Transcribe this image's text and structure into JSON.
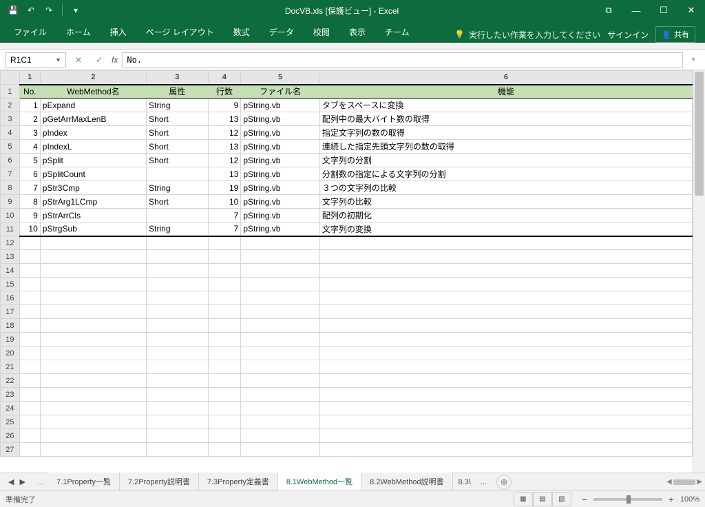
{
  "title": "DocVB.xls  [保護ビュー] - Excel",
  "qat": {
    "save": "💾",
    "undo": "↶",
    "redo": "↷",
    "more": "▾"
  },
  "win": {
    "restore_size": "⧉",
    "min": "—",
    "max": "☐",
    "close": "✕"
  },
  "ribbon": {
    "tabs": [
      "ファイル",
      "ホーム",
      "挿入",
      "ページ レイアウト",
      "数式",
      "データ",
      "校閲",
      "表示",
      "チーム"
    ],
    "tell_me": "実行したい作業を入力してください",
    "signin": "サインイン",
    "share": "共有"
  },
  "name_box": "R1C1",
  "formula": "No.",
  "col_headers": [
    "1",
    "2",
    "3",
    "4",
    "5",
    "6"
  ],
  "row_headers": [
    "1",
    "2",
    "3",
    "4",
    "5",
    "6",
    "7",
    "8",
    "9",
    "10",
    "11",
    "12",
    "13",
    "14",
    "15",
    "16",
    "17",
    "18",
    "19",
    "20",
    "21",
    "22",
    "23",
    "24",
    "25",
    "26",
    "27"
  ],
  "table": {
    "headers": [
      "No.",
      "WebMethod名",
      "属性",
      "行数",
      "ファイル名",
      "機能"
    ],
    "rows": [
      {
        "no": "1",
        "name": "pExpand",
        "attr": "String",
        "lines": "9",
        "file": "pString.vb",
        "func": "タブをスペースに変換"
      },
      {
        "no": "2",
        "name": "pGetArrMaxLenB",
        "attr": "Short",
        "lines": "13",
        "file": "pString.vb",
        "func": "配列中の最大バイト数の取得"
      },
      {
        "no": "3",
        "name": "pIndex",
        "attr": "Short",
        "lines": "12",
        "file": "pString.vb",
        "func": "指定文字列の数の取得"
      },
      {
        "no": "4",
        "name": "pIndexL",
        "attr": "Short",
        "lines": "13",
        "file": "pString.vb",
        "func": "連続した指定先頭文字列の数の取得"
      },
      {
        "no": "5",
        "name": "pSplit",
        "attr": "Short",
        "lines": "12",
        "file": "pString.vb",
        "func": "文字列の分割"
      },
      {
        "no": "6",
        "name": "pSplitCount",
        "attr": "",
        "lines": "13",
        "file": "pString.vb",
        "func": "分割数の指定による文字列の分割"
      },
      {
        "no": "7",
        "name": "pStr3Cmp",
        "attr": "String",
        "lines": "19",
        "file": "pString.vb",
        "func": "３つの文字列の比較"
      },
      {
        "no": "8",
        "name": "pStrArg1LCmp",
        "attr": "Short",
        "lines": "10",
        "file": "pString.vb",
        "func": "文字列の比較"
      },
      {
        "no": "9",
        "name": "pStrArrCls",
        "attr": "",
        "lines": "7",
        "file": "pString.vb",
        "func": "配列の初期化"
      },
      {
        "no": "10",
        "name": "pStrgSub",
        "attr": "String",
        "lines": "7",
        "file": "pString.vb",
        "func": "文字列の変換"
      }
    ]
  },
  "sheet_tabs": {
    "tabs": [
      "7.1Property一覧",
      "7.2Property説明書",
      "7.3Property定義書",
      "8.1WebMethod一覧",
      "8.2WebMethod説明書"
    ],
    "active": 3,
    "more": "8.3\\"
  },
  "status": {
    "ready": "準備完了",
    "zoom": "100%"
  }
}
